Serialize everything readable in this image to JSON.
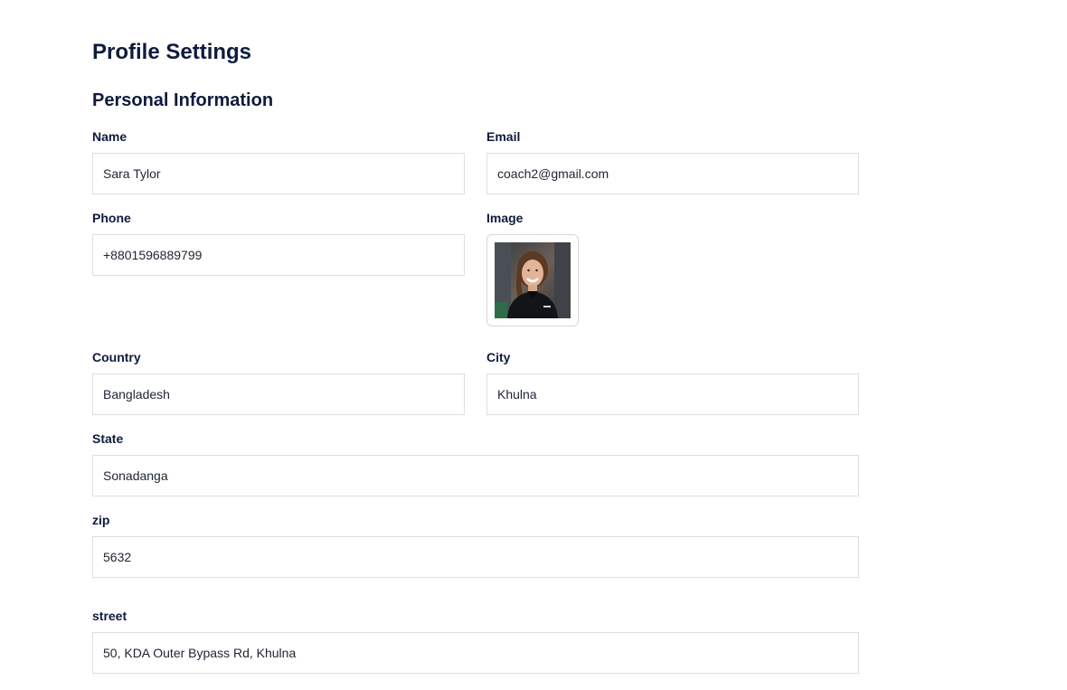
{
  "page": {
    "title": "Profile Settings",
    "section_title": "Personal Information"
  },
  "fields": {
    "name": {
      "label": "Name",
      "value": "Sara Tylor"
    },
    "email": {
      "label": "Email",
      "value": "coach2@gmail.com"
    },
    "phone": {
      "label": "Phone",
      "value": "+8801596889799"
    },
    "image": {
      "label": "Image"
    },
    "country": {
      "label": "Country",
      "value": "Bangladesh"
    },
    "city": {
      "label": "City",
      "value": "Khulna"
    },
    "state": {
      "label": "State",
      "value": "Sonadanga"
    },
    "zip": {
      "label": "zip",
      "value": "5632"
    },
    "street": {
      "label": "street",
      "value": "50, KDA Outer Bypass Rd, Khulna"
    }
  }
}
